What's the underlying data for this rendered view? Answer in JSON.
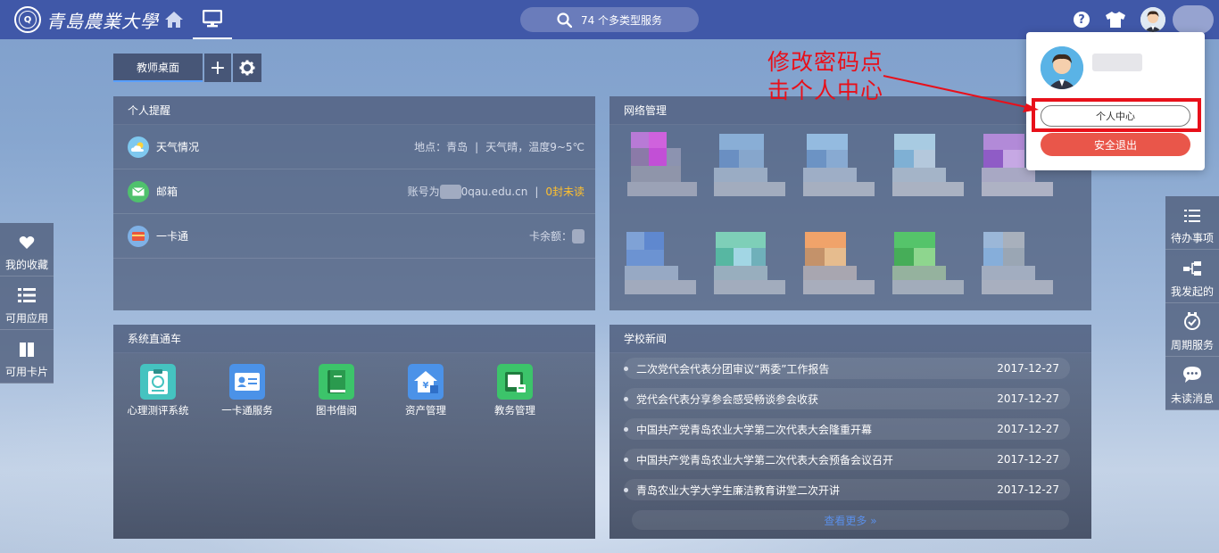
{
  "header": {
    "logo_text": "青島農業大學",
    "search_label": "74 个多类型服务"
  },
  "desktop_tabs": {
    "active_tab": "教师桌面",
    "add_label": "+"
  },
  "personal_reminder": {
    "title": "个人提醒",
    "weather": {
      "label": "天气情况",
      "location": "地点：青岛",
      "separator": "|",
      "detail": "天气晴，温度9~5℃"
    },
    "mail": {
      "label": "邮箱",
      "account_prefix": "账号为",
      "account_suffix": "0qau.edu.cn",
      "separator": "|",
      "unread": "0封未读"
    },
    "card": {
      "label": "一卡通",
      "balance_label": "卡余额："
    }
  },
  "network": {
    "title": "网络管理"
  },
  "systems": {
    "title": "系统直通车",
    "apps": [
      {
        "label": "心理测评系统",
        "icon": "psychology-test-icon",
        "color": "#45c3c0"
      },
      {
        "label": "一卡通服务",
        "icon": "card-service-icon",
        "color": "#4b92e8"
      },
      {
        "label": "图书借阅",
        "icon": "book-icon",
        "color": "#3cc46a"
      },
      {
        "label": "资产管理",
        "icon": "asset-house-icon",
        "color": "#4b92e8"
      },
      {
        "label": "教务管理",
        "icon": "academic-icon",
        "color": "#3cc46a"
      }
    ]
  },
  "news": {
    "title": "学校新闻",
    "items": [
      {
        "title": "二次党代会代表分团审议“两委”工作报告",
        "date": "2017-12-27"
      },
      {
        "title": "党代会代表分享参会感受畅谈参会收获",
        "date": "2017-12-27"
      },
      {
        "title": "中国共产党青岛农业大学第二次代表大会隆重开幕",
        "date": "2017-12-27"
      },
      {
        "title": "中国共产党青岛农业大学第二次代表大会预备会议召开",
        "date": "2017-12-27"
      },
      {
        "title": "青岛农业大学大学生廉洁教育讲堂二次开讲",
        "date": "2017-12-27"
      }
    ],
    "more_label": "查看更多 »"
  },
  "left_dock": [
    {
      "label": "我的收藏",
      "icon": "heart-icon"
    },
    {
      "label": "可用应用",
      "icon": "list-icon"
    },
    {
      "label": "可用卡片",
      "icon": "cards-icon"
    }
  ],
  "right_dock": [
    {
      "label": "待办事项",
      "icon": "todo-list-icon"
    },
    {
      "label": "我发起的",
      "icon": "flow-icon"
    },
    {
      "label": "周期服务",
      "icon": "cycle-check-icon"
    },
    {
      "label": "未读消息",
      "icon": "message-icon"
    }
  ],
  "user_menu": {
    "center_label": "个人中心",
    "logout_label": "安全退出"
  },
  "annotation": {
    "line1": "修改密码点",
    "line2": "击个人中心"
  },
  "colors": {
    "topbar": "#4058a8",
    "highlight": "#e8101a",
    "unread": "#ffc02e",
    "logout": "#e9564a"
  }
}
